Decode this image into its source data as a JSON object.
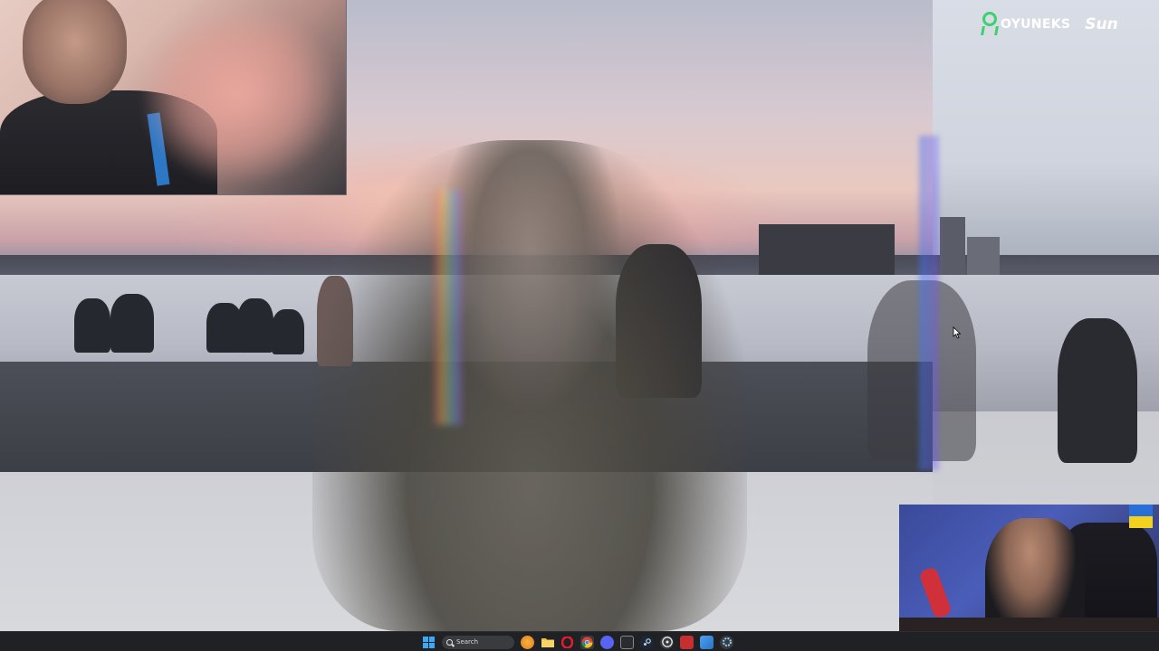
{
  "window": {
    "type": "fullscreen-video-stream"
  },
  "logos": {
    "oyuneks": "OYUNEKS",
    "sun": "Sun"
  },
  "taskbar": {
    "search_placeholder": "Search",
    "icons": [
      "windows-start-icon",
      "search-icon",
      "game-app-icon",
      "file-explorer-icon",
      "opera-icon",
      "chrome-icon",
      "discord-icon",
      "stream-deck-icon",
      "steam-icon",
      "obs-icon",
      "media-app-icon",
      "photos-icon",
      "settings-app-icon"
    ]
  },
  "colors": {
    "oyuneks_green": "#3bd16f",
    "taskbar_bg": "#202124",
    "flag_blue": "#2a6ed8",
    "flag_yellow": "#f2d21e"
  }
}
